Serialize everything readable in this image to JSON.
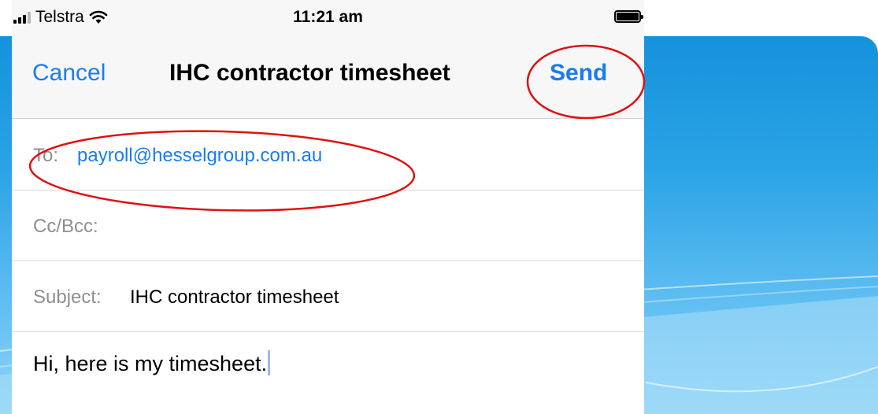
{
  "status_bar": {
    "carrier": "Telstra",
    "time": "11:21 am"
  },
  "compose": {
    "cancel_label": "Cancel",
    "title": "IHC contractor timesheet",
    "send_label": "Send",
    "to_label": "To:",
    "to_value": "payroll@hesselgroup.com.au",
    "cc_label": "Cc/Bcc:",
    "subject_label": "Subject:",
    "subject_value": "IHC contractor timesheet",
    "body": "Hi, here is my timesheet."
  },
  "icons": {
    "signal": "cellular-signal-icon",
    "wifi": "wifi-icon",
    "battery": "battery-icon"
  },
  "colors": {
    "link_blue": "#1a7cf0",
    "annotation_red": "#e01010",
    "slide_blue_top": "#1592dc",
    "slide_blue_bottom": "#8fd4f8"
  }
}
